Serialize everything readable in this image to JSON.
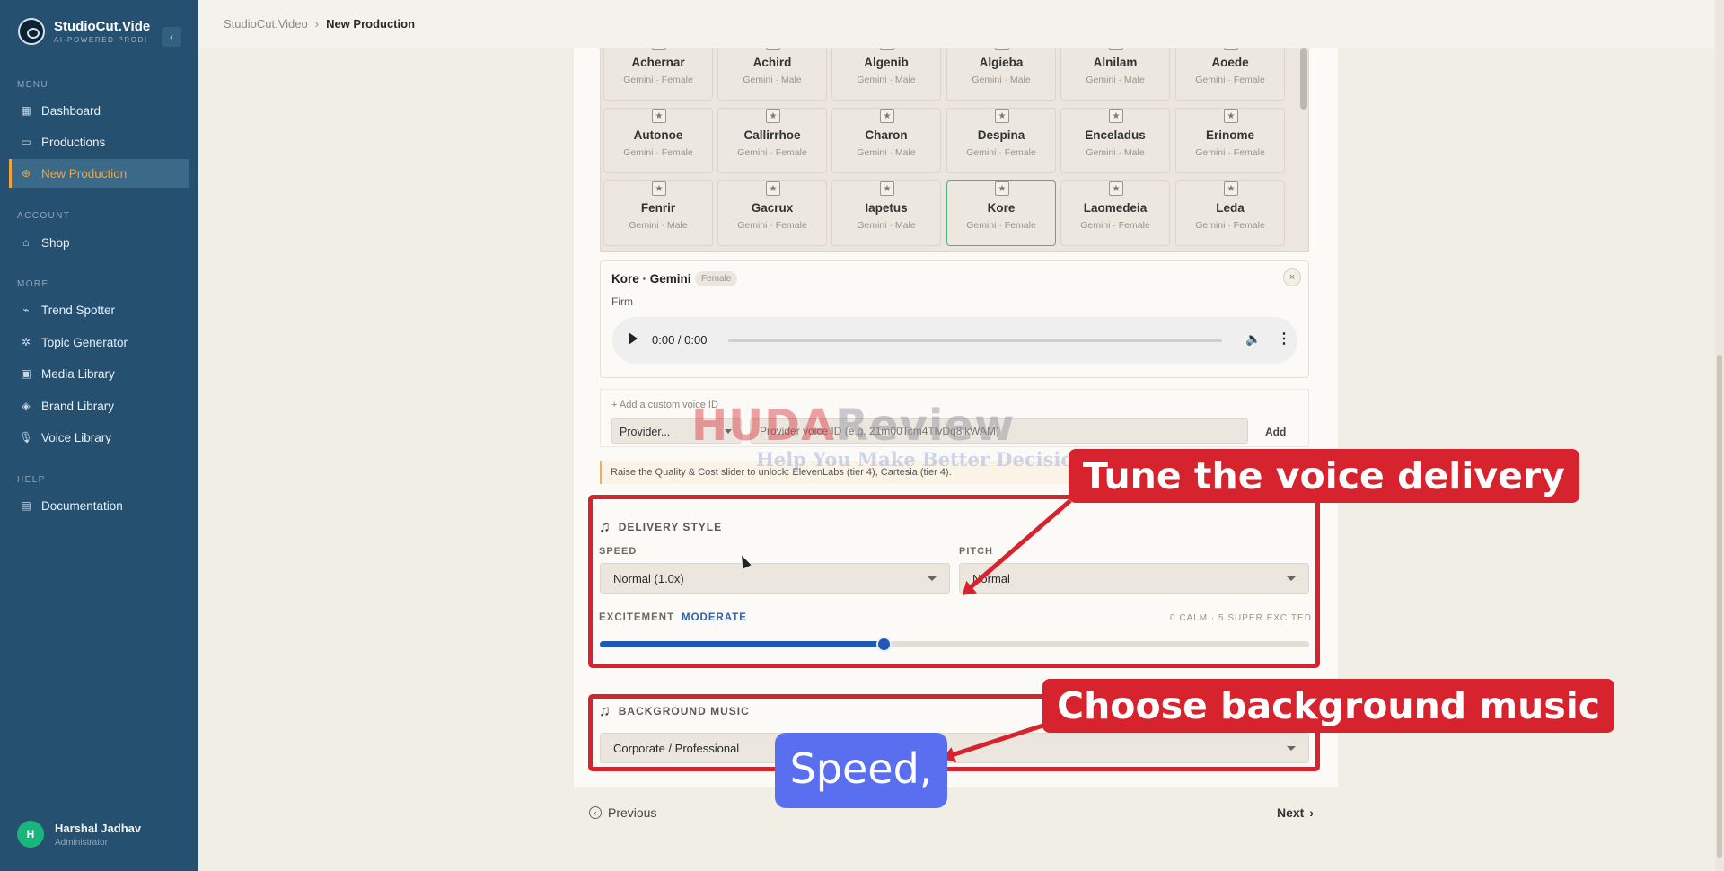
{
  "app": {
    "name": "StudioCut.Vide",
    "tagline": "AI-POWERED PRODI"
  },
  "sidebar": {
    "sections": {
      "menu": "MENU",
      "account": "ACCOUNT",
      "more": "MORE",
      "help": "HELP"
    },
    "items": [
      {
        "label": "Dashboard",
        "icon": "grid-icon"
      },
      {
        "label": "Productions",
        "icon": "folder-icon"
      },
      {
        "label": "New Production",
        "icon": "plus-circle-icon",
        "active": true
      },
      {
        "label": "Shop",
        "icon": "shop-icon"
      },
      {
        "label": "Trend Spotter",
        "icon": "trend-icon"
      },
      {
        "label": "Topic Generator",
        "icon": "sparkle-icon"
      },
      {
        "label": "Media Library",
        "icon": "image-icon"
      },
      {
        "label": "Brand Library",
        "icon": "tag-icon"
      },
      {
        "label": "Voice Library",
        "icon": "mic-icon"
      },
      {
        "label": "Documentation",
        "icon": "book-icon"
      }
    ],
    "user": {
      "initial": "H",
      "name": "Harshal Jadhav",
      "role": "Administrator"
    }
  },
  "breadcrumb": {
    "root": "StudioCut.Video",
    "sep": "›",
    "current": "New Production"
  },
  "voices": [
    {
      "name": "Achernar",
      "meta": "Gemini · Female"
    },
    {
      "name": "Achird",
      "meta": "Gemini · Male"
    },
    {
      "name": "Algenib",
      "meta": "Gemini · Male"
    },
    {
      "name": "Algieba",
      "meta": "Gemini · Male"
    },
    {
      "name": "Alnilam",
      "meta": "Gemini · Male"
    },
    {
      "name": "Aoede",
      "meta": "Gemini · Female"
    },
    {
      "name": "Autonoe",
      "meta": "Gemini · Female"
    },
    {
      "name": "Callirrhoe",
      "meta": "Gemini · Female"
    },
    {
      "name": "Charon",
      "meta": "Gemini · Male"
    },
    {
      "name": "Despina",
      "meta": "Gemini · Female"
    },
    {
      "name": "Enceladus",
      "meta": "Gemini · Male"
    },
    {
      "name": "Erinome",
      "meta": "Gemini · Female"
    },
    {
      "name": "Fenrir",
      "meta": "Gemini · Male"
    },
    {
      "name": "Gacrux",
      "meta": "Gemini · Female"
    },
    {
      "name": "Iapetus",
      "meta": "Gemini · Male"
    },
    {
      "name": "Kore",
      "meta": "Gemini · Female",
      "selected": true
    },
    {
      "name": "Laomedeia",
      "meta": "Gemini · Female"
    },
    {
      "name": "Leda",
      "meta": "Gemini · Female"
    }
  ],
  "selected_voice": {
    "title": "Kore · Gemini",
    "badge": "Female",
    "description": "Firm",
    "close": "×",
    "audio_time": "0:00 / 0:00"
  },
  "custom_voice": {
    "label": "+ Add a custom voice ID",
    "provider": "Provider...",
    "placeholder": "Provider voice ID (e.g. 21m00Tcm4TlvDq8ikWAM)",
    "add": "Add"
  },
  "notice": "Raise the Quality & Cost slider to unlock: ElevenLabs (tier 4), Cartesia (tier 4).",
  "delivery": {
    "title": "DELIVERY STYLE",
    "speed_label": "SPEED",
    "speed_value": "Normal (1.0x)",
    "pitch_label": "PITCH",
    "pitch_value": "Normal",
    "excitement_label": "EXCITEMENT",
    "excitement_value": "MODERATE",
    "excitement_range": "0 CALM · 5 SUPER EXCITED",
    "excitement_level": 2,
    "excitement_max": 5
  },
  "music": {
    "title": "BACKGROUND MUSIC",
    "value": "Corporate / Professional"
  },
  "footer_nav": {
    "previous": "Previous",
    "next": "Next",
    "prev_icon": "‹",
    "next_icon": "›"
  },
  "overlays": {
    "callout_delivery": "Tune the voice delivery",
    "callout_music": "Choose background music",
    "caption": "Speed,",
    "watermark_main_a": "HUDA",
    "watermark_main_b": "Review",
    "watermark_sub": "Help You Make Better Decisions"
  },
  "colors": {
    "sidebar": "#26506f",
    "accent": "#f3a33a",
    "slider": "#1e58b8",
    "annotation": "#d6232e",
    "caption": "#5a6ff0"
  }
}
